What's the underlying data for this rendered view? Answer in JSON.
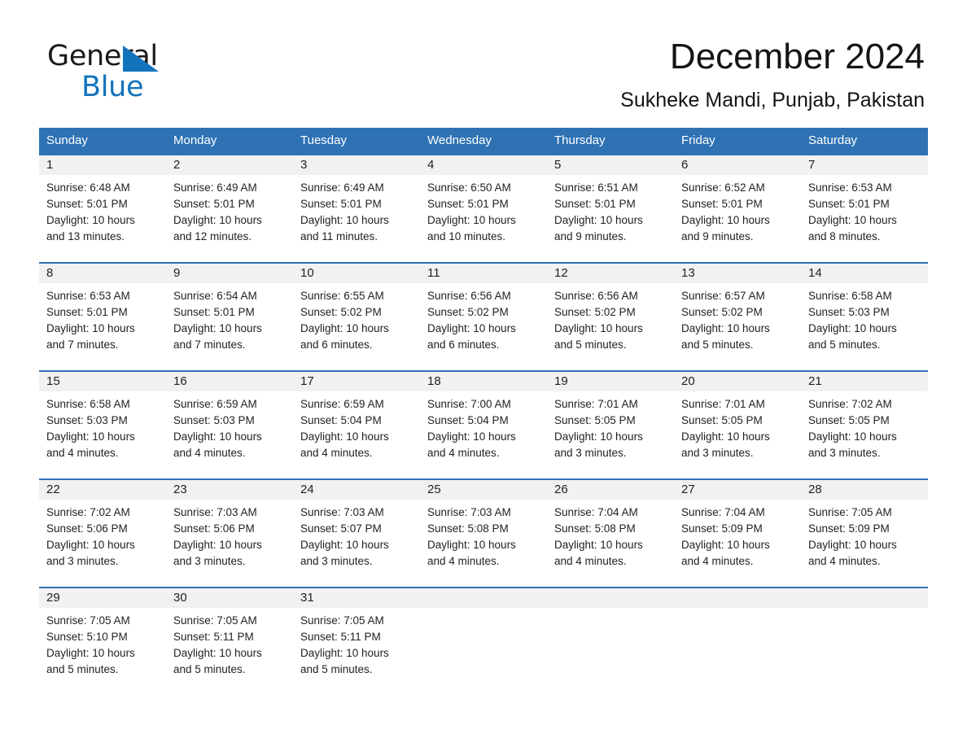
{
  "logo": {
    "word1": "General",
    "word2": "Blue",
    "triangle_color": "#1273bd"
  },
  "header": {
    "month_title": "December 2024",
    "location": "Sukheke Mandi, Punjab, Pakistan"
  },
  "theme": {
    "header_blue": "#2e72b4",
    "daynum_band": "#f1f1f1",
    "text": "#222222"
  },
  "calendar": {
    "weekday_headers": [
      "Sunday",
      "Monday",
      "Tuesday",
      "Wednesday",
      "Thursday",
      "Friday",
      "Saturday"
    ],
    "weeks": [
      [
        {
          "day": "1",
          "sunrise": "Sunrise: 6:48 AM",
          "sunset": "Sunset: 5:01 PM",
          "daylight_line1": "Daylight: 10 hours",
          "daylight_line2": "and 13 minutes."
        },
        {
          "day": "2",
          "sunrise": "Sunrise: 6:49 AM",
          "sunset": "Sunset: 5:01 PM",
          "daylight_line1": "Daylight: 10 hours",
          "daylight_line2": "and 12 minutes."
        },
        {
          "day": "3",
          "sunrise": "Sunrise: 6:49 AM",
          "sunset": "Sunset: 5:01 PM",
          "daylight_line1": "Daylight: 10 hours",
          "daylight_line2": "and 11 minutes."
        },
        {
          "day": "4",
          "sunrise": "Sunrise: 6:50 AM",
          "sunset": "Sunset: 5:01 PM",
          "daylight_line1": "Daylight: 10 hours",
          "daylight_line2": "and 10 minutes."
        },
        {
          "day": "5",
          "sunrise": "Sunrise: 6:51 AM",
          "sunset": "Sunset: 5:01 PM",
          "daylight_line1": "Daylight: 10 hours",
          "daylight_line2": "and 9 minutes."
        },
        {
          "day": "6",
          "sunrise": "Sunrise: 6:52 AM",
          "sunset": "Sunset: 5:01 PM",
          "daylight_line1": "Daylight: 10 hours",
          "daylight_line2": "and 9 minutes."
        },
        {
          "day": "7",
          "sunrise": "Sunrise: 6:53 AM",
          "sunset": "Sunset: 5:01 PM",
          "daylight_line1": "Daylight: 10 hours",
          "daylight_line2": "and 8 minutes."
        }
      ],
      [
        {
          "day": "8",
          "sunrise": "Sunrise: 6:53 AM",
          "sunset": "Sunset: 5:01 PM",
          "daylight_line1": "Daylight: 10 hours",
          "daylight_line2": "and 7 minutes."
        },
        {
          "day": "9",
          "sunrise": "Sunrise: 6:54 AM",
          "sunset": "Sunset: 5:01 PM",
          "daylight_line1": "Daylight: 10 hours",
          "daylight_line2": "and 7 minutes."
        },
        {
          "day": "10",
          "sunrise": "Sunrise: 6:55 AM",
          "sunset": "Sunset: 5:02 PM",
          "daylight_line1": "Daylight: 10 hours",
          "daylight_line2": "and 6 minutes."
        },
        {
          "day": "11",
          "sunrise": "Sunrise: 6:56 AM",
          "sunset": "Sunset: 5:02 PM",
          "daylight_line1": "Daylight: 10 hours",
          "daylight_line2": "and 6 minutes."
        },
        {
          "day": "12",
          "sunrise": "Sunrise: 6:56 AM",
          "sunset": "Sunset: 5:02 PM",
          "daylight_line1": "Daylight: 10 hours",
          "daylight_line2": "and 5 minutes."
        },
        {
          "day": "13",
          "sunrise": "Sunrise: 6:57 AM",
          "sunset": "Sunset: 5:02 PM",
          "daylight_line1": "Daylight: 10 hours",
          "daylight_line2": "and 5 minutes."
        },
        {
          "day": "14",
          "sunrise": "Sunrise: 6:58 AM",
          "sunset": "Sunset: 5:03 PM",
          "daylight_line1": "Daylight: 10 hours",
          "daylight_line2": "and 5 minutes."
        }
      ],
      [
        {
          "day": "15",
          "sunrise": "Sunrise: 6:58 AM",
          "sunset": "Sunset: 5:03 PM",
          "daylight_line1": "Daylight: 10 hours",
          "daylight_line2": "and 4 minutes."
        },
        {
          "day": "16",
          "sunrise": "Sunrise: 6:59 AM",
          "sunset": "Sunset: 5:03 PM",
          "daylight_line1": "Daylight: 10 hours",
          "daylight_line2": "and 4 minutes."
        },
        {
          "day": "17",
          "sunrise": "Sunrise: 6:59 AM",
          "sunset": "Sunset: 5:04 PM",
          "daylight_line1": "Daylight: 10 hours",
          "daylight_line2": "and 4 minutes."
        },
        {
          "day": "18",
          "sunrise": "Sunrise: 7:00 AM",
          "sunset": "Sunset: 5:04 PM",
          "daylight_line1": "Daylight: 10 hours",
          "daylight_line2": "and 4 minutes."
        },
        {
          "day": "19",
          "sunrise": "Sunrise: 7:01 AM",
          "sunset": "Sunset: 5:05 PM",
          "daylight_line1": "Daylight: 10 hours",
          "daylight_line2": "and 3 minutes."
        },
        {
          "day": "20",
          "sunrise": "Sunrise: 7:01 AM",
          "sunset": "Sunset: 5:05 PM",
          "daylight_line1": "Daylight: 10 hours",
          "daylight_line2": "and 3 minutes."
        },
        {
          "day": "21",
          "sunrise": "Sunrise: 7:02 AM",
          "sunset": "Sunset: 5:05 PM",
          "daylight_line1": "Daylight: 10 hours",
          "daylight_line2": "and 3 minutes."
        }
      ],
      [
        {
          "day": "22",
          "sunrise": "Sunrise: 7:02 AM",
          "sunset": "Sunset: 5:06 PM",
          "daylight_line1": "Daylight: 10 hours",
          "daylight_line2": "and 3 minutes."
        },
        {
          "day": "23",
          "sunrise": "Sunrise: 7:03 AM",
          "sunset": "Sunset: 5:06 PM",
          "daylight_line1": "Daylight: 10 hours",
          "daylight_line2": "and 3 minutes."
        },
        {
          "day": "24",
          "sunrise": "Sunrise: 7:03 AM",
          "sunset": "Sunset: 5:07 PM",
          "daylight_line1": "Daylight: 10 hours",
          "daylight_line2": "and 3 minutes."
        },
        {
          "day": "25",
          "sunrise": "Sunrise: 7:03 AM",
          "sunset": "Sunset: 5:08 PM",
          "daylight_line1": "Daylight: 10 hours",
          "daylight_line2": "and 4 minutes."
        },
        {
          "day": "26",
          "sunrise": "Sunrise: 7:04 AM",
          "sunset": "Sunset: 5:08 PM",
          "daylight_line1": "Daylight: 10 hours",
          "daylight_line2": "and 4 minutes."
        },
        {
          "day": "27",
          "sunrise": "Sunrise: 7:04 AM",
          "sunset": "Sunset: 5:09 PM",
          "daylight_line1": "Daylight: 10 hours",
          "daylight_line2": "and 4 minutes."
        },
        {
          "day": "28",
          "sunrise": "Sunrise: 7:05 AM",
          "sunset": "Sunset: 5:09 PM",
          "daylight_line1": "Daylight: 10 hours",
          "daylight_line2": "and 4 minutes."
        }
      ],
      [
        {
          "day": "29",
          "sunrise": "Sunrise: 7:05 AM",
          "sunset": "Sunset: 5:10 PM",
          "daylight_line1": "Daylight: 10 hours",
          "daylight_line2": "and 5 minutes."
        },
        {
          "day": "30",
          "sunrise": "Sunrise: 7:05 AM",
          "sunset": "Sunset: 5:11 PM",
          "daylight_line1": "Daylight: 10 hours",
          "daylight_line2": "and 5 minutes."
        },
        {
          "day": "31",
          "sunrise": "Sunrise: 7:05 AM",
          "sunset": "Sunset: 5:11 PM",
          "daylight_line1": "Daylight: 10 hours",
          "daylight_line2": "and 5 minutes."
        },
        {
          "day": "",
          "sunrise": "",
          "sunset": "",
          "daylight_line1": "",
          "daylight_line2": ""
        },
        {
          "day": "",
          "sunrise": "",
          "sunset": "",
          "daylight_line1": "",
          "daylight_line2": ""
        },
        {
          "day": "",
          "sunrise": "",
          "sunset": "",
          "daylight_line1": "",
          "daylight_line2": ""
        },
        {
          "day": "",
          "sunrise": "",
          "sunset": "",
          "daylight_line1": "",
          "daylight_line2": ""
        }
      ]
    ]
  }
}
